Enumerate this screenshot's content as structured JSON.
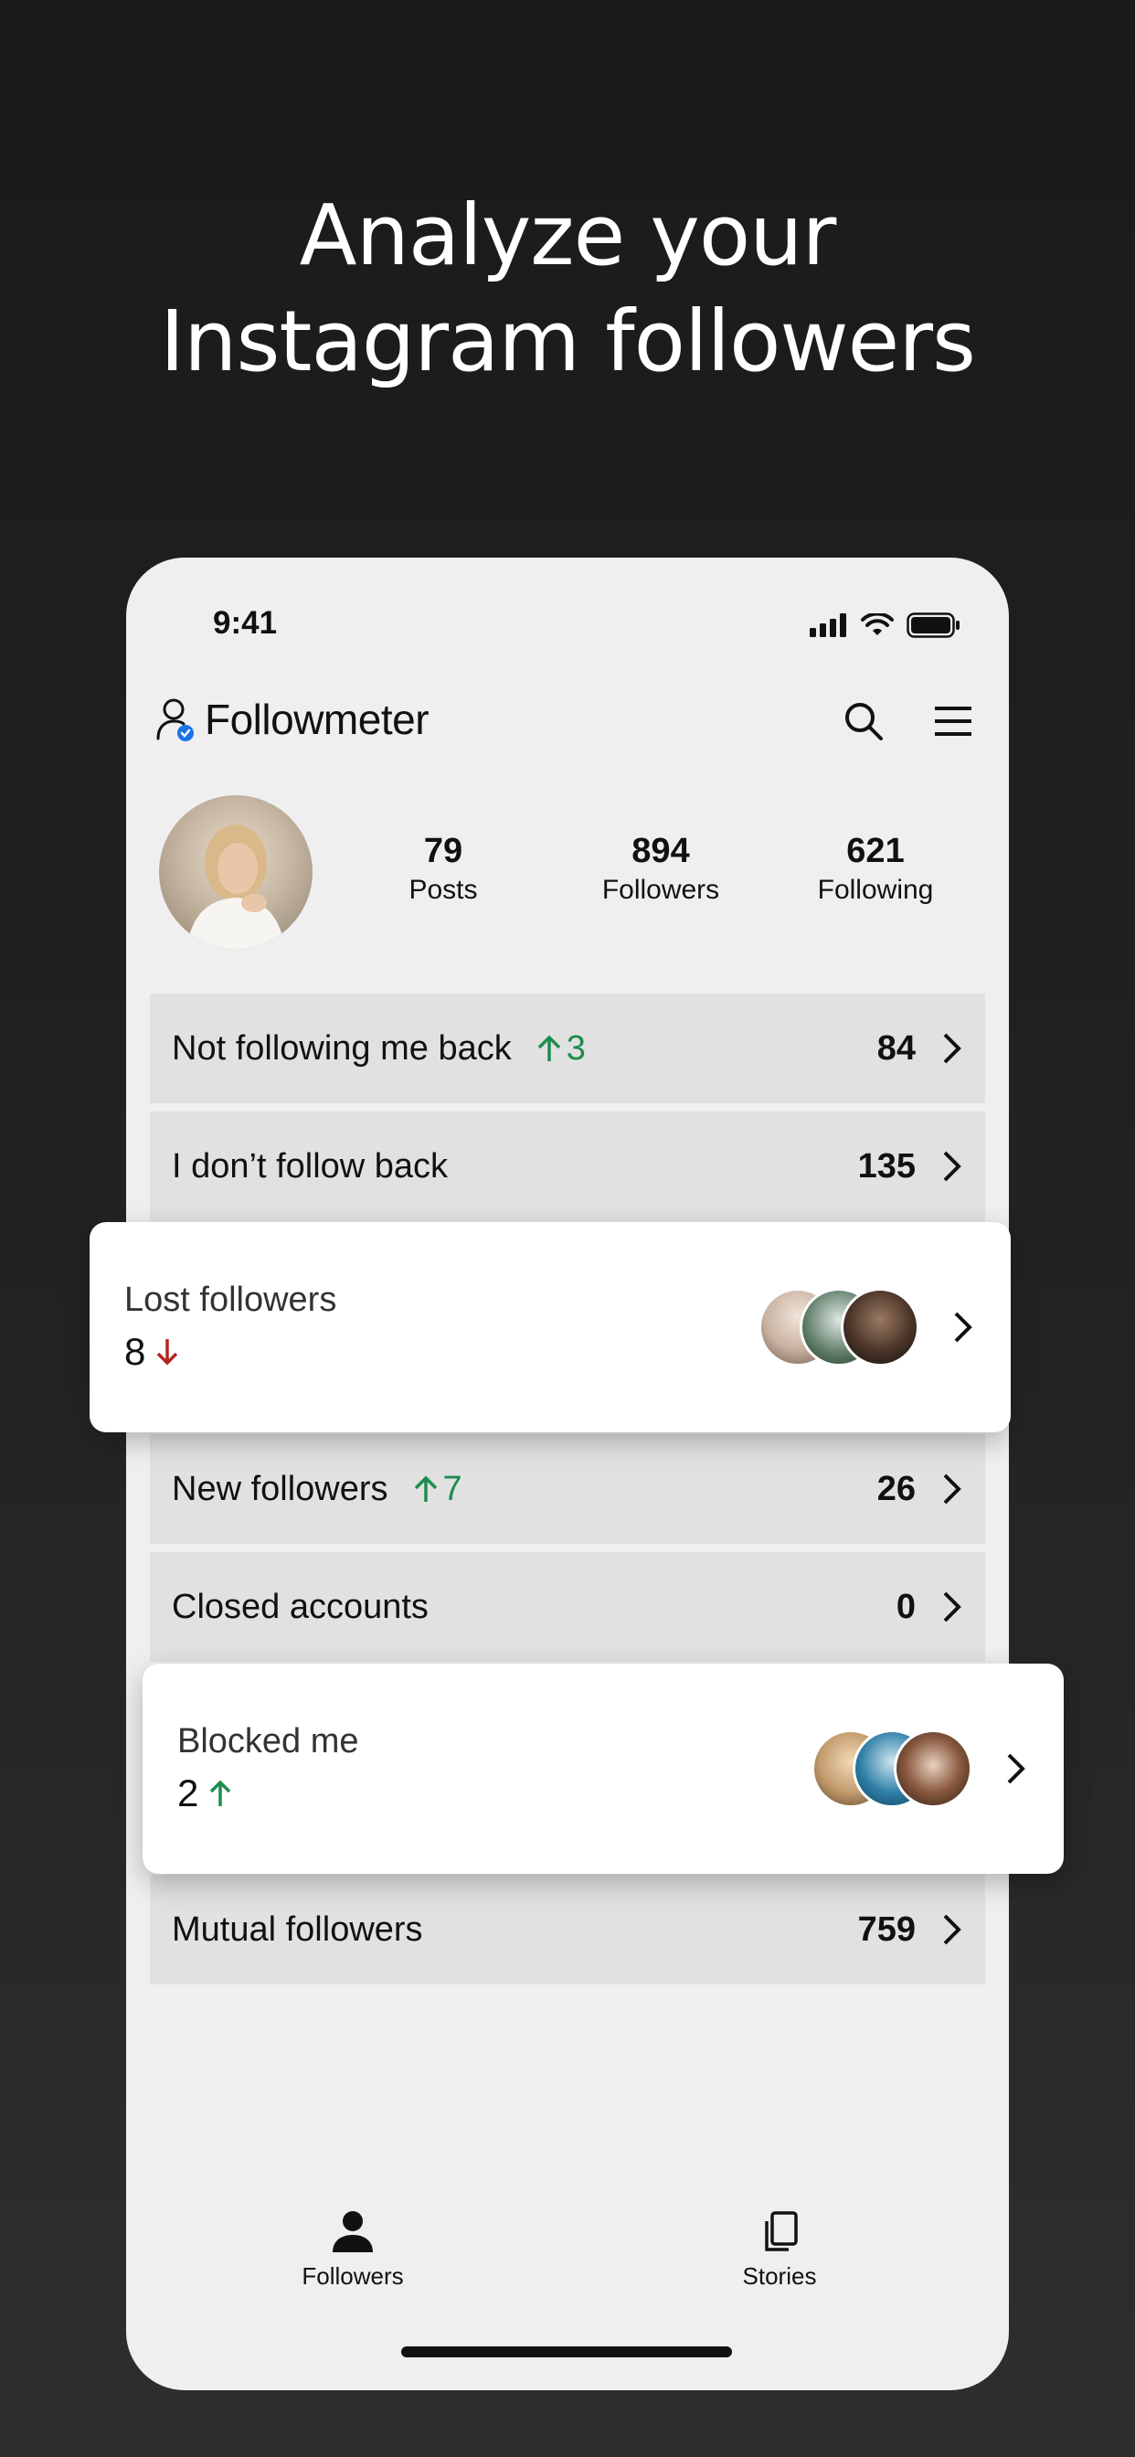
{
  "headline": {
    "line1": "Analyze your",
    "line2": "Instagram followers"
  },
  "status_bar": {
    "time": "9:41"
  },
  "app": {
    "name": "Followmeter"
  },
  "profile": {
    "stats": [
      {
        "value": "79",
        "label": "Posts"
      },
      {
        "value": "894",
        "label": "Followers"
      },
      {
        "value": "621",
        "label": "Following"
      }
    ]
  },
  "rows": [
    {
      "title": "Not following me back",
      "delta": "3",
      "delta_dir": "up",
      "count": "84"
    },
    {
      "title": "I don’t follow back",
      "count": "135"
    },
    {
      "title": "New followers",
      "delta": "7",
      "delta_dir": "up",
      "count": "26"
    },
    {
      "title": "Closed accounts",
      "count": "0"
    },
    {
      "title": "Mutual followers",
      "count": "759"
    }
  ],
  "cards": {
    "lost": {
      "title": "Lost followers",
      "value": "8",
      "direction": "down"
    },
    "blocked": {
      "title": "Blocked me",
      "value": "2",
      "direction": "up"
    }
  },
  "tabs": [
    {
      "label": "Followers",
      "icon": "person-icon"
    },
    {
      "label": "Stories",
      "icon": "stories-icon"
    }
  ],
  "colors": {
    "increase": "#1e8c4e",
    "decrease": "#b3261e",
    "row_bg": "#e1e1e1",
    "phone_bg": "#efefef"
  }
}
